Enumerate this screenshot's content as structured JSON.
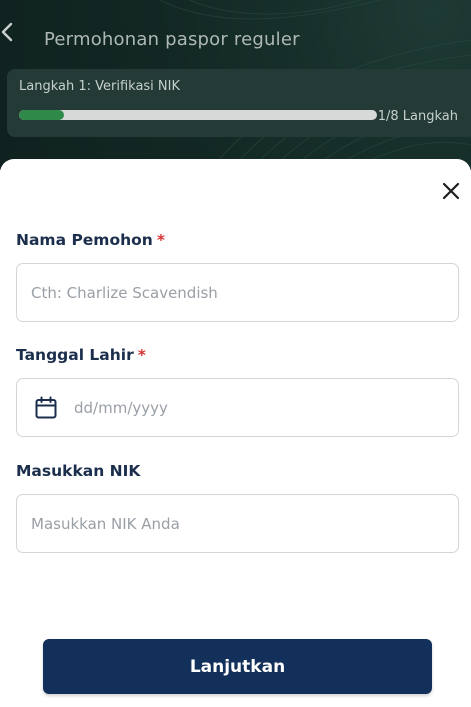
{
  "header": {
    "title": "Permohonan paspor reguler",
    "back_icon": "chevron-left-icon"
  },
  "progress": {
    "step_label": "Langkah 1: Verifikasi NIK",
    "step_count": "1/8 Langkah",
    "fraction": 0.125,
    "fill_color": "#2f8a4a"
  },
  "form": {
    "close_icon": "close-icon",
    "name": {
      "label": "Nama Pemohon",
      "required_mark": "*",
      "placeholder": "Cth: Charlize Scavendish"
    },
    "dob": {
      "label": "Tanggal Lahir",
      "required_mark": "*",
      "placeholder": "dd/mm/yyyy",
      "icon": "calendar-icon"
    },
    "nik": {
      "label": "Masukkan NIK",
      "placeholder": "Masukkan NIK Anda"
    },
    "submit_label": "Lanjutkan"
  },
  "colors": {
    "header_bg": "#122723",
    "primary_button": "#13305a",
    "label_text": "#1b2f4d",
    "required": "#d63434"
  }
}
